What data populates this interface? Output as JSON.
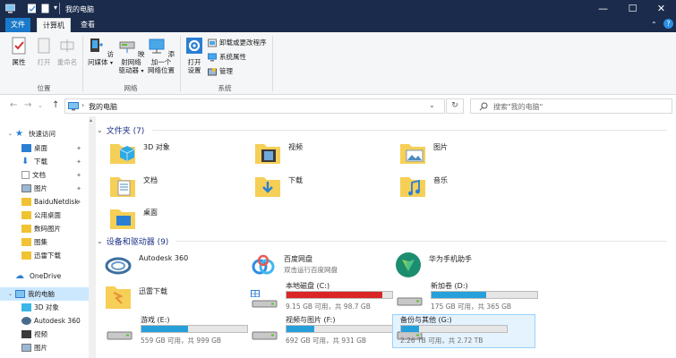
{
  "window": {
    "title": "我的电脑",
    "minimize": "—",
    "maximize": "☐",
    "close": "✕"
  },
  "tabs": [
    {
      "label": "文件"
    },
    {
      "label": "计算机"
    },
    {
      "label": "查看"
    }
  ],
  "ribbon": {
    "location": {
      "group": "位置",
      "properties": "属性",
      "open": "打开",
      "rename": "重命名"
    },
    "network": {
      "group": "网络",
      "media_l1": "访问媒体",
      "drive_l1": "映射网络",
      "drive_l2": "驱动器",
      "add_l1": "添加一个",
      "add_l2": "网络位置"
    },
    "system": {
      "group": "系统",
      "settings_l1": "打开",
      "settings_l2": "设置",
      "uninstall": "卸载或更改程序",
      "sysprops": "系统属性",
      "manage": "管理"
    }
  },
  "address": {
    "path": "我的电脑",
    "search_placeholder": "搜索\"我的电脑\""
  },
  "sidebar": {
    "items": [
      {
        "label": "快速访问"
      },
      {
        "label": "桌面"
      },
      {
        "label": "下载"
      },
      {
        "label": "文档"
      },
      {
        "label": "图片"
      },
      {
        "label": "BaiduNetdisk"
      },
      {
        "label": "公用桌面"
      },
      {
        "label": "数码图片"
      },
      {
        "label": "图集"
      },
      {
        "label": "迅雷下载"
      },
      {
        "label": "OneDrive"
      },
      {
        "label": "我的电脑"
      },
      {
        "label": "3D 对象"
      },
      {
        "label": "Autodesk 360"
      },
      {
        "label": "视频"
      },
      {
        "label": "图片"
      }
    ]
  },
  "folders_section": {
    "title": "文件夹 (7)",
    "items": [
      {
        "label": "3D 对象"
      },
      {
        "label": "视频"
      },
      {
        "label": "图片"
      },
      {
        "label": "文档"
      },
      {
        "label": "下载"
      },
      {
        "label": "音乐"
      },
      {
        "label": "桌面"
      }
    ]
  },
  "devices_section": {
    "title": "设备和驱动器 (9)",
    "apps": [
      {
        "name": "Autodesk 360",
        "sub": ""
      },
      {
        "name": "百度网盘",
        "sub": "双击运行百度网盘"
      },
      {
        "name": "华为手机助手",
        "sub": ""
      },
      {
        "name": "迅雷下载",
        "sub": ""
      }
    ],
    "drives": [
      {
        "name": "本地磁盘 (C:)",
        "capacity": "9.15 GB 可用，共 98.7 GB",
        "used": 0.907
      },
      {
        "name": "新加卷 (D:)",
        "capacity": "175 GB 可用，共 365 GB",
        "used": 0.52
      },
      {
        "name": "游戏 (E:)",
        "capacity": "559 GB 可用，共 999 GB",
        "used": 0.44
      },
      {
        "name": "视频与图片 (F:)",
        "capacity": "692 GB 可用，共 931 GB",
        "used": 0.26
      },
      {
        "name": "备份与其他 (G:)",
        "capacity": "2.26 TB 可用，共 2.72 TB",
        "used": 0.17
      }
    ]
  },
  "colors": {
    "titlebar": "#1b2b4b",
    "accent": "#26a0da",
    "danger": "#da2626",
    "selected": "#cce8ff"
  }
}
